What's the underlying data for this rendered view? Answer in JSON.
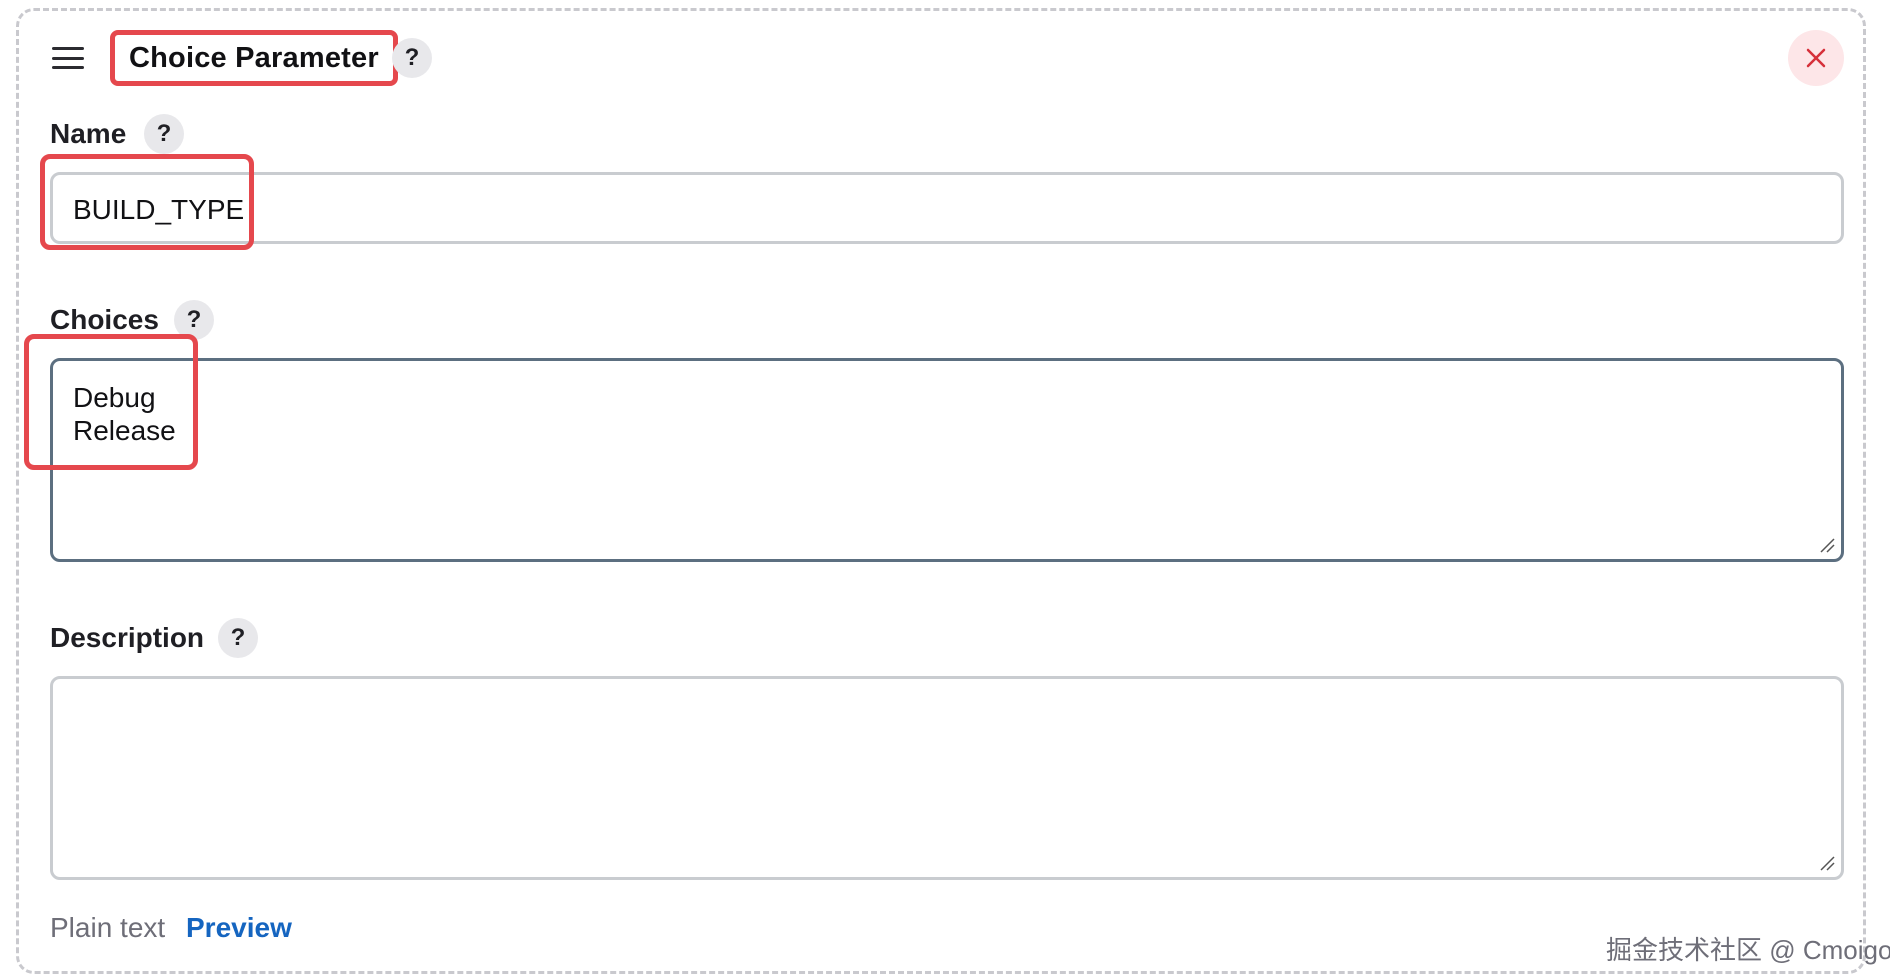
{
  "parameter": {
    "title": "Choice Parameter",
    "help_symbol": "?",
    "close_icon": "close-x-icon",
    "drag_icon": "hamburger-drag-icon"
  },
  "fields": {
    "name": {
      "label": "Name",
      "value": "BUILD_TYPE"
    },
    "choices": {
      "label": "Choices",
      "lines": [
        "Debug",
        "Release"
      ]
    },
    "description": {
      "label": "Description",
      "value": ""
    }
  },
  "footer": {
    "plain_text": "Plain text",
    "preview": "Preview"
  },
  "watermark": "掘金技术社区 @ Cmoigo",
  "colors": {
    "highlight": "#e5484d",
    "link": "#1565c0",
    "close_bg": "#fde6e8",
    "close_icon": "#d6303a"
  }
}
